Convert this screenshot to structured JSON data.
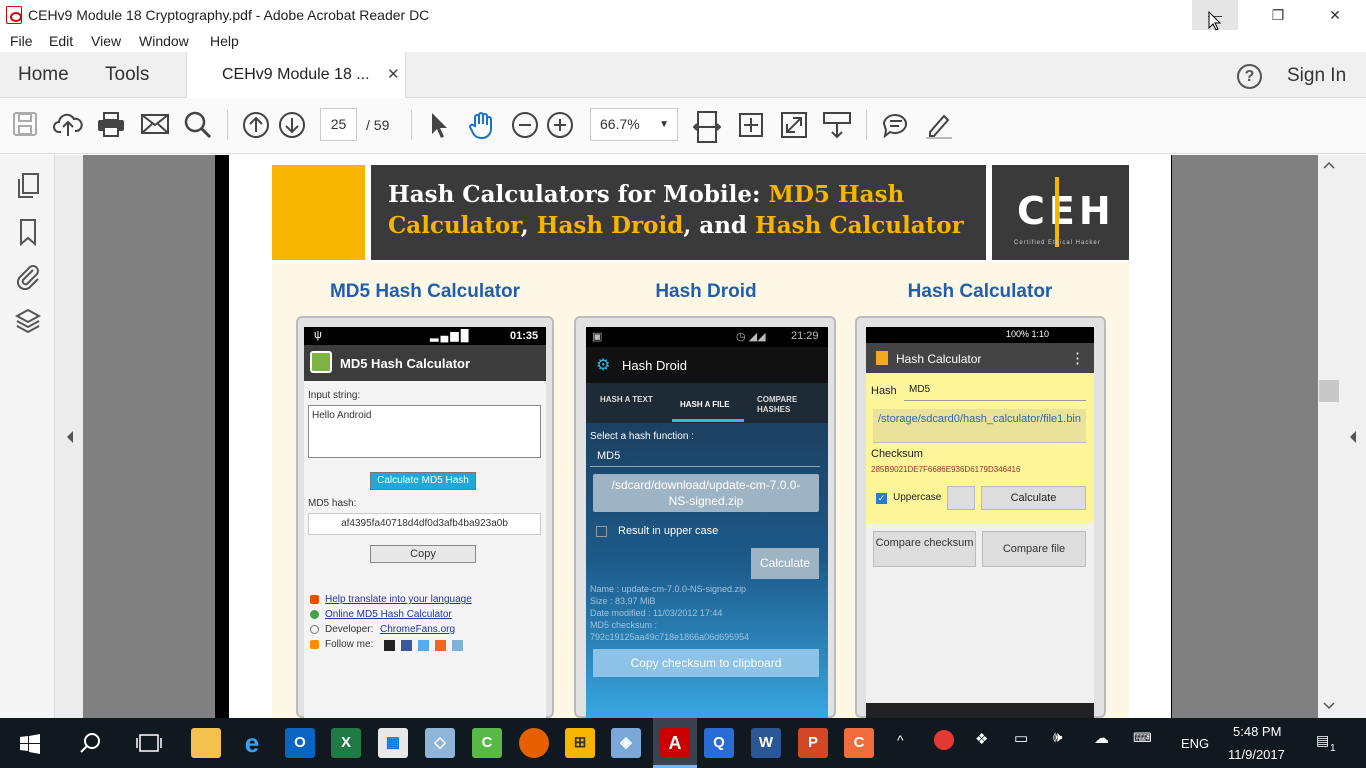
{
  "window": {
    "title": "CEHv9 Module 18 Cryptography.pdf - Adobe Acrobat Reader DC",
    "minimize": "—",
    "restore": "❐",
    "close": "✕"
  },
  "menu": [
    "File",
    "Edit",
    "View",
    "Window",
    "Help"
  ],
  "tabs": {
    "home": "Home",
    "tools": "Tools",
    "doc_tab": "CEHv9 Module 18 ...",
    "doc_tab_close": "✕",
    "help": "?",
    "sign_in": "Sign In"
  },
  "toolbar": {
    "page_current": "25",
    "page_total": "/  59",
    "zoom": "66.7%",
    "zoom_caret": "▼"
  },
  "slide": {
    "banner_part1": "Hash Calculators for Mobile: ",
    "banner_part2": "MD5 Hash Calculator",
    "banner_part3": ", ",
    "banner_part4": "Hash Droid",
    "banner_part5": ", and ",
    "banner_part6": "Hash Calculator",
    "logo": "CEH",
    "logo_sub": "Certified   Ethical   Hacker",
    "columns": [
      "MD5 Hash Calculator",
      "Hash Droid",
      "Hash Calculator"
    ]
  },
  "phone1": {
    "time": "01:35",
    "app_title": "MD5 Hash Calculator",
    "input_label": "Input string:",
    "input_value": "Hello Android",
    "calc_button": "Calculate MD5 Hash",
    "hash_label": "MD5 hash:",
    "hash_value": "af4395fa40718d4df0d3afb4ba923a0b",
    "copy_button": "Copy",
    "link1": "Help translate into your language",
    "link2": "Online MD5 Hash Calculator",
    "dev_label": "Developer: ",
    "dev_link": "ChromeFans.org",
    "follow": "Follow me:"
  },
  "phone2": {
    "time": "21:29",
    "app_title": "Hash Droid",
    "tabs": [
      "HASH A TEXT",
      "HASH A FILE",
      "COMPARE HASHES"
    ],
    "select_label": "Select a hash function :",
    "function": "MD5",
    "file_path": "/sdcard/download/update-cm-7.0.0-NS-signed.zip",
    "upper_case": "Result in upper case",
    "calc_button": "Calculate",
    "info": [
      "Name : update-cm-7.0.0-NS-signed.zip",
      "Size : 83,97 MiB",
      "Date modified : 11/03/2012 17:44",
      "MD5 checksum :",
      "792c19125aa49c718e1866a06d695954"
    ],
    "copy_button": "Copy checksum to clipboard"
  },
  "phone3": {
    "status": "100%  1:10",
    "app_title": "Hash Calculator",
    "menu_dots": "⋮",
    "hash_label": "Hash",
    "hash_value": "MD5",
    "file_path": "/storage/sdcard0/hash_calculator/file1.bin",
    "checksum_label": "Checksum",
    "checksum_value": "285B9021DE7F6686E936D6179D346416",
    "uppercase_label": "Uppercase",
    "calc_button": "Calculate",
    "compare_checksum": "Compare checksum",
    "compare_file": "Compare file"
  },
  "taskbar": {
    "time": "5:48 PM",
    "date": "11/9/2017",
    "lang": "ENG",
    "notif_count": "1"
  },
  "colors": {
    "accent_yellow": "#f7b500",
    "banner_dark": "#3a3a3a",
    "column_title_blue": "#1f5fae",
    "taskbar": "#101820"
  }
}
